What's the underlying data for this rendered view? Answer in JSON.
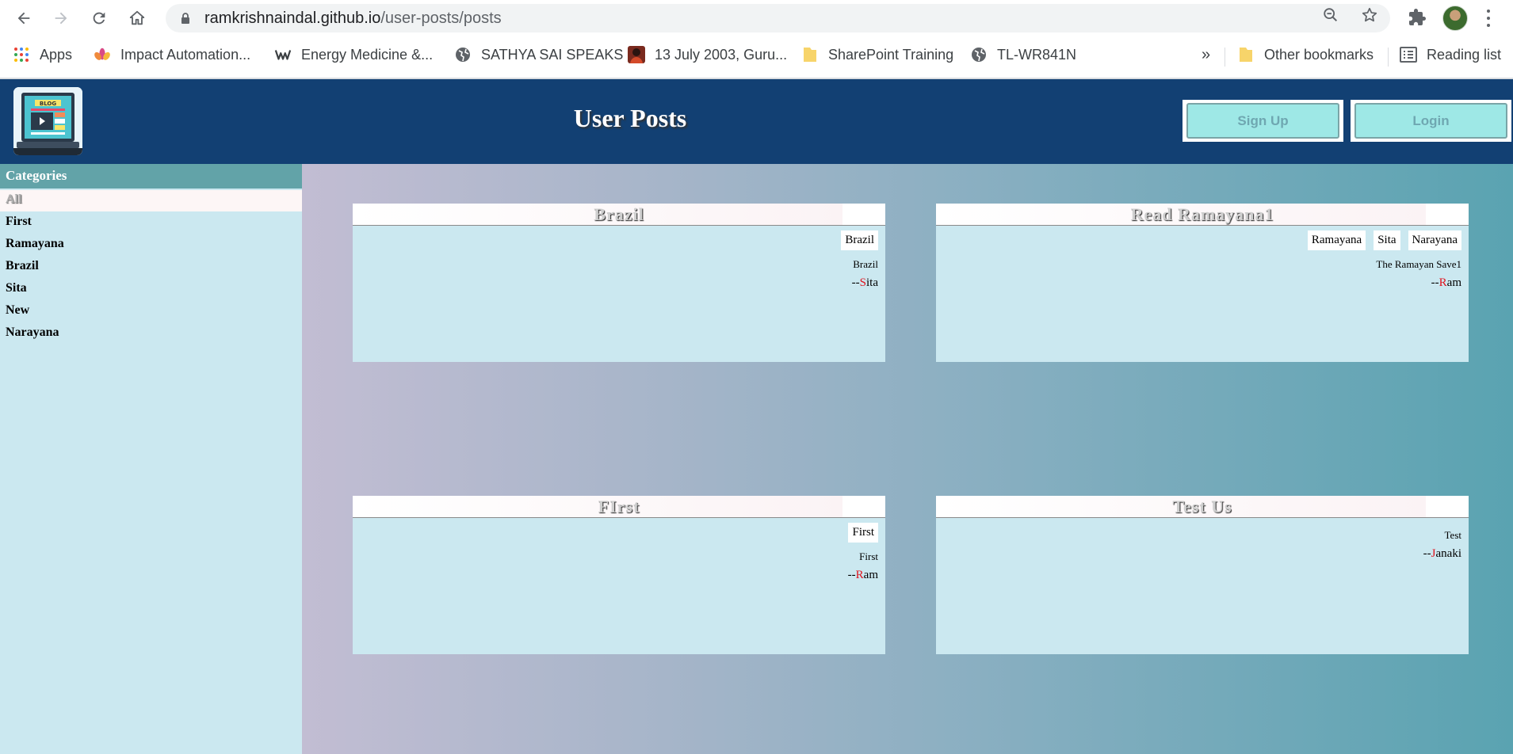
{
  "browser": {
    "url_host": "ramkrishnaindal.github.io",
    "url_path": "/user-posts/posts",
    "bookmarks": [
      {
        "label": "Apps",
        "icon": "apps-grid-icon"
      },
      {
        "label": "Impact Automation...",
        "icon": "lotus-icon"
      },
      {
        "label": "Energy Medicine &...",
        "icon": "weebly-w-icon"
      },
      {
        "label": "SATHYA SAI SPEAKS",
        "icon": "globe-icon"
      },
      {
        "label": "13 July 2003, Guru...",
        "icon": "person-icon"
      },
      {
        "label": "SharePoint Training",
        "icon": "folder-icon"
      },
      {
        "label": "TL-WR841N",
        "icon": "globe-icon"
      }
    ],
    "overflow_label": "»",
    "other_bookmarks": "Other bookmarks",
    "reading_list": "Reading list"
  },
  "header": {
    "title": "User Posts",
    "signup_label": "Sign Up",
    "login_label": "Login",
    "logo_text": "BLOG"
  },
  "sidebar": {
    "heading": "Categories",
    "items": [
      {
        "label": "All",
        "active": true
      },
      {
        "label": "First",
        "active": false
      },
      {
        "label": "Ramayana",
        "active": false
      },
      {
        "label": "Brazil",
        "active": false
      },
      {
        "label": "Sita",
        "active": false
      },
      {
        "label": "New",
        "active": false
      },
      {
        "label": "Narayana",
        "active": false
      }
    ]
  },
  "posts": [
    {
      "title": "Brazil",
      "tags": [
        "Brazil"
      ],
      "body": "Brazil",
      "author_prefix": "--",
      "author_initial": "S",
      "author_rest": "ita"
    },
    {
      "title": "Read Ramayana1",
      "tags": [
        "Ramayana",
        "Sita",
        "Narayana"
      ],
      "body": "The Ramayan Save1",
      "author_prefix": "--",
      "author_initial": "R",
      "author_rest": "am"
    },
    {
      "title": "FIrst",
      "tags": [
        "First"
      ],
      "body": "First",
      "author_prefix": "--",
      "author_initial": "R",
      "author_rest": "am"
    },
    {
      "title": "Test Us",
      "tags": [],
      "body": "Test",
      "author_prefix": "--",
      "author_initial": "J",
      "author_rest": "anaki"
    }
  ],
  "colors": {
    "header_bg": "#124073",
    "sidebar_bg": "#cbe8f0",
    "category_header_bg": "#62a3a8",
    "button_bg": "#9ee8e6",
    "author_initial": "#e0141e"
  }
}
